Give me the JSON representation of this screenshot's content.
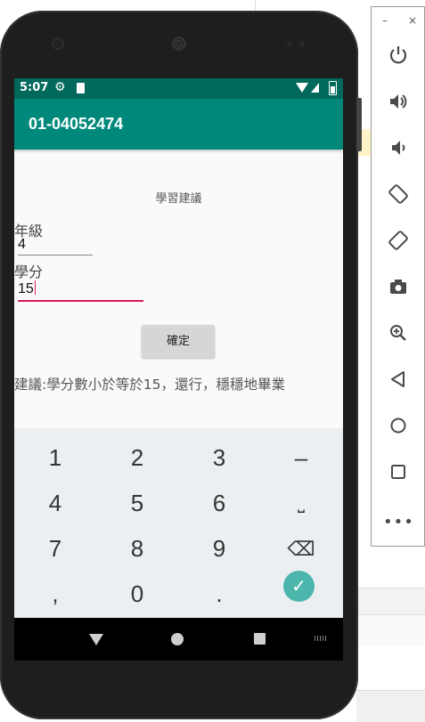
{
  "statusbar": {
    "time": "5:07"
  },
  "appbar": {
    "title": "01-04052474"
  },
  "form": {
    "heading": "學習建議",
    "grade_label": "年級",
    "grade_value": "4",
    "credit_label": "學分",
    "credit_value": "15",
    "confirm_label": "確定",
    "advice": "建議:學分數小於等於15，還行，穩穩地畢業"
  },
  "keyboard": {
    "keys": [
      "1",
      "2",
      "3",
      "–",
      "4",
      "5",
      "6",
      "⎵",
      "7",
      "8",
      "9",
      "⌫",
      ",",
      "0",
      "."
    ],
    "accent": "#4db6ac"
  },
  "emulator_toolbar": {
    "window_controls": [
      "–",
      "×"
    ],
    "buttons": [
      "power-icon",
      "volume-up-icon",
      "volume-down-icon",
      "rotate-left-icon",
      "rotate-right-icon",
      "camera-icon",
      "zoom-icon",
      "back-icon",
      "home-icon",
      "overview-icon",
      "more-icon"
    ]
  },
  "colors": {
    "statusbar": "#00695c",
    "appbar": "#00897b",
    "focus_underline": "#d81b60"
  }
}
